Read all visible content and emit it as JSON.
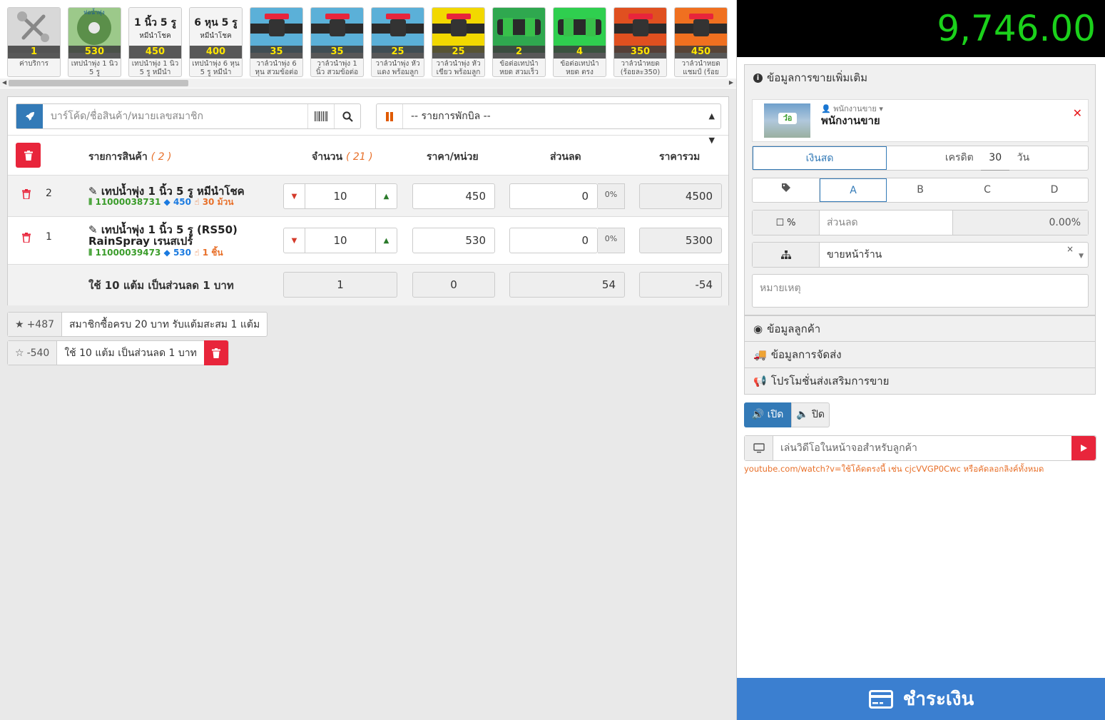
{
  "products": [
    {
      "count": "1",
      "name": "ค่าบริการ",
      "icon": "wrench-screwdriver-icon",
      "color": "#d8d8d8"
    },
    {
      "count": "530",
      "name": "เทปน้ำพุ่ง 1 นิ้ว 5 รู",
      "icon": "tape-roll-icon",
      "color": "#9cc98a",
      "label": "ท่อน้ำพุ่ง"
    },
    {
      "count": "450",
      "name": "เทปน้ำพุ่ง 1 นิ้ว 5 รู หมีนำ",
      "icon": "text-label-icon",
      "color": "#f4f4f4",
      "label": "1 นิ้ว 5 รู",
      "sublabel": "หมีนำโชค"
    },
    {
      "count": "400",
      "name": "เทปน้ำพุ่ง 6 หุน 5 รู หมีนำ",
      "icon": "text-label-icon",
      "color": "#f4f4f4",
      "label": "6 หุน 5 รู",
      "sublabel": "หมีนำโชค"
    },
    {
      "count": "35",
      "name": "วาล์วน้ำพุ่ง 6 หุน สวมข้อต่อ",
      "icon": "valve-icon",
      "color": "#5bb0d8"
    },
    {
      "count": "35",
      "name": "วาล์วน้ำพุ่ง 1 นิ้ว สวมข้อต่อ",
      "icon": "valve-icon",
      "color": "#5bb0d8"
    },
    {
      "count": "25",
      "name": "วาล์วน้ำพุ่ง หัวแดง พร้อมลูก",
      "icon": "valve-icon",
      "color": "#5bb0d8"
    },
    {
      "count": "25",
      "name": "วาล์วน้ำพุ่ง หัวเขียว พร้อมลูก",
      "icon": "valve-icon",
      "color": "#f2d800"
    },
    {
      "count": "2",
      "name": "ข้อต่อเทปน้ำหยด สวมเร็ว",
      "icon": "connector-icon",
      "color": "#2fa84f"
    },
    {
      "count": "4",
      "name": "ข้อต่อเทปน้ำหยด ตรง",
      "icon": "connector-icon",
      "color": "#2fcf4f"
    },
    {
      "count": "350",
      "name": "วาล์วน้ำหยด (ร้อยละ350)",
      "icon": "valve-icon",
      "color": "#e05020"
    },
    {
      "count": "450",
      "name": "วาล์วน้ำหยด แชมป์ (ร้อย",
      "icon": "valve-icon",
      "color": "#f07020"
    }
  ],
  "search": {
    "placeholder": "บาร์โค้ด/ชื่อสินค้า/หมายเลขสมาชิก"
  },
  "hold_bill": {
    "selected": "-- รายการพักบิล --"
  },
  "table": {
    "col_item": "รายการสินค้า",
    "item_count": "( 2 )",
    "col_qty": "จำนวน",
    "qty_count": "( 21 )",
    "col_price": "ราคา/หน่วย",
    "col_discount": "ส่วนลด",
    "col_total": "ราคารวม"
  },
  "rows": [
    {
      "seq": "2",
      "name": "เทปน้ำพุ่ง 1 นิ้ว 5 รู หมีนำโชค",
      "name2": "",
      "barcode": "11000038731",
      "price_tag": "450",
      "stock": "30 ม้วน",
      "qty": "10",
      "price": "450",
      "discount": "0",
      "pct": "0%",
      "total": "4500"
    },
    {
      "seq": "1",
      "name": "เทปน้ำพุ่ง 1 นิ้ว 5 รู (RS50)",
      "name2": "RainSpray เรนสเปร์",
      "barcode": "11000039473",
      "price_tag": "530",
      "stock": "1 ชิ้น",
      "qty": "10",
      "price": "530",
      "discount": "0",
      "pct": "0%",
      "total": "5300"
    }
  ],
  "redeem_row": {
    "label": "ใช้ 10 แต้ม เป็นส่วนลด 1 บาท",
    "qty": "1",
    "price": "0",
    "discount": "54",
    "total": "-54"
  },
  "points": [
    {
      "value": "+487",
      "text": "สมาชิกซื้อครบ 20 บาท รับแต้มสะสม 1 แต้ม"
    },
    {
      "value": "-540",
      "text": "ใช้ 10 แต้ม เป็นส่วนลด 1 บาท"
    }
  ],
  "grand_total": "9,746.00",
  "sales_info": {
    "title": "ข้อมูลการขายเพิ่มเติม",
    "staff_role": "พนักงานขาย",
    "staff_name": "พนักงานขาย",
    "cash": "เงินสด",
    "credit": "เครดิต",
    "credit_days": "30",
    "days": "วัน",
    "price_levels": [
      "A",
      "B",
      "C",
      "D"
    ],
    "discount_toggle": "%",
    "discount_placeholder": "ส่วนลด",
    "discount_value": "0.00%",
    "channel": "ขายหน้าร้าน",
    "notes_placeholder": "หมายเหตุ"
  },
  "accordion": {
    "customer": "ข้อมูลลูกค้า",
    "shipping": "ข้อมูลการจัดส่ง",
    "promotion": "โปรโมชั่นส่งเสริมการขาย"
  },
  "sound": {
    "on": "เปิด",
    "off": "ปิด"
  },
  "video": {
    "placeholder": "เล่นวิดีโอในหน้าจอสำหรับลูกค้า",
    "hint": "youtube.com/watch?v=ใช้โค้ดตรงนี้ เช่น cjcVVGP0Cwc หรือคัดลอกลิงค์ทั้งหมด"
  },
  "pay_label": "ชำระเงิน",
  "colors": {
    "accent": "#337ab7",
    "danger": "#e8253b",
    "total_green": "#1bd11b",
    "orange": "#e8702a"
  }
}
